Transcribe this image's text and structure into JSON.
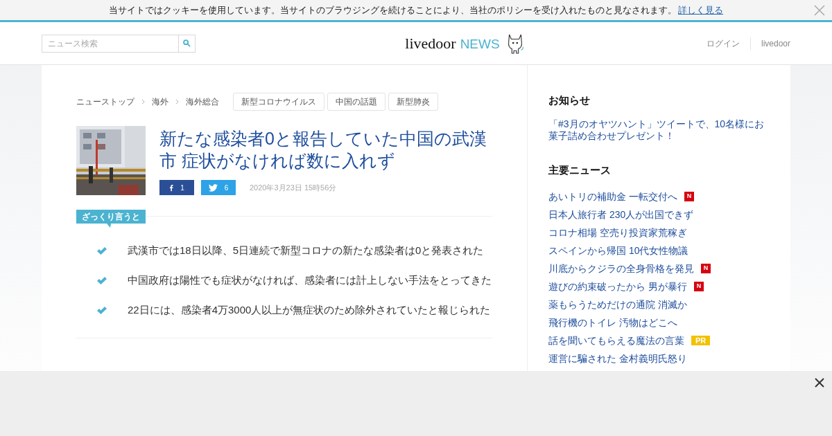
{
  "cookie_bar": {
    "text": "当サイトではクッキーを使用しています。当サイトのブラウジングを続けることにより、当社のポリシーを受け入れたものと見なされます。",
    "link": "詳しく見る"
  },
  "header": {
    "search": {
      "placeholder": "ニュース検索"
    },
    "logo": {
      "brand": "livedoor",
      "product": "NEWS"
    },
    "links": [
      "ログイン",
      "livedoor"
    ]
  },
  "breadcrumbs": [
    "ニューストップ",
    "海外",
    "海外総合"
  ],
  "tags": [
    "新型コロナウイルス",
    "中国の話題",
    "新型肺炎"
  ],
  "article": {
    "title": "新たな感染者0と報告していた中国の武漢市 症状がなければ数に入れず",
    "shares": [
      {
        "kind": "facebook",
        "count": "1"
      },
      {
        "kind": "twitter",
        "count": "6"
      }
    ],
    "date": "2020年3月23日 15時56分"
  },
  "summary": {
    "label": "ざっくり言うと",
    "points": [
      "武漢市では18日以降、5日連続で新型コロナの新たな感染者は0と発表された",
      "中国政府は陽性でも症状がなければ、感染者には計上しない手法をとってきた",
      "22日には、感染者4万3000人以上が無症状のため除外されていたと報じられた"
    ]
  },
  "sidebar": {
    "notice": {
      "title": "お知らせ",
      "text": "「#3月のオヤツハント」ツイートで、10名様にお菓子詰め合わせプレゼント！"
    },
    "top_news": {
      "title": "主要ニュース",
      "items": [
        {
          "title": "あいトリの補助金 一転交付へ",
          "badge": {
            "kind": "new",
            "label": "N"
          }
        },
        {
          "title": "日本人旅行者 230人が出国できず"
        },
        {
          "title": "コロナ相場 空売り投資家荒稼ぎ"
        },
        {
          "title": "スペインから帰国 10代女性物議"
        },
        {
          "title": "川底からクジラの全身骨格を発見",
          "badge": {
            "kind": "new",
            "label": "N"
          }
        },
        {
          "title": "遊びの約束破ったから 男が暴行",
          "badge": {
            "kind": "new",
            "label": "N"
          }
        },
        {
          "title": "薬もらうためだけの通院 消滅か"
        },
        {
          "title": "飛行機のトイレ 汚物はどこへ"
        },
        {
          "title": "話を聞いてもらえる魔法の言葉",
          "badge": {
            "kind": "pr",
            "label": "PR"
          }
        },
        {
          "title": "運営に騙された 金村義明氏怒り"
        }
      ]
    }
  },
  "ad_bar": {
    "kind": "empty"
  }
}
